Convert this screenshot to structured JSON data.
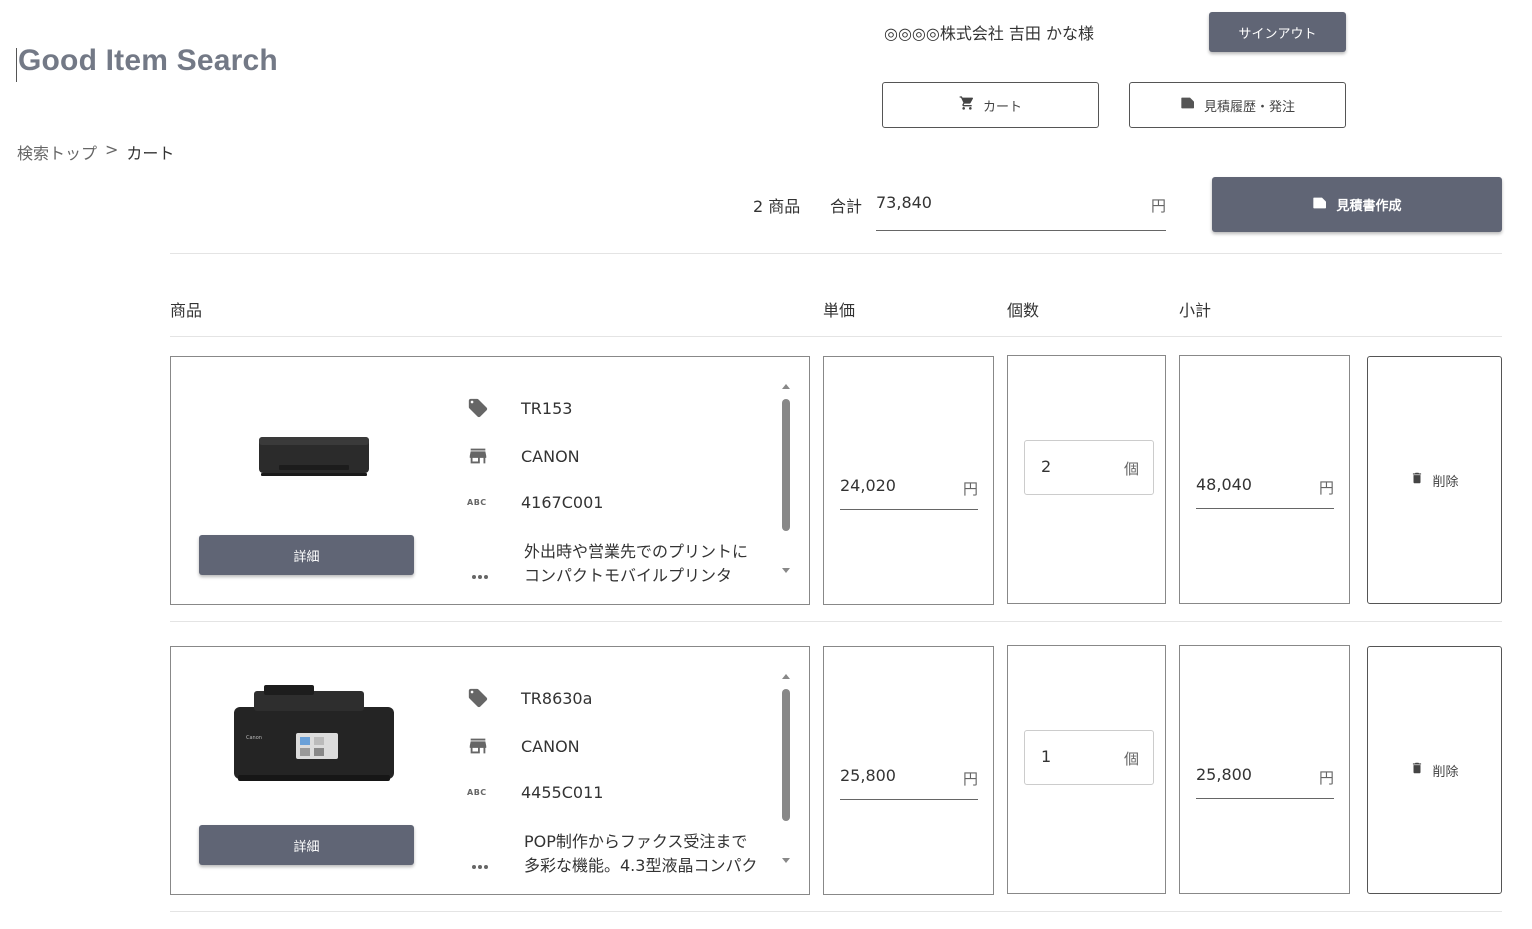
{
  "header": {
    "logo": "Good Item Search",
    "user_name": "◎◎◎◎株式会社 吉田 かな様",
    "signout_label": "サインアウト",
    "cart_label": "カート",
    "history_label": "見積履歴・発注"
  },
  "breadcrumb": {
    "top": "検索トップ",
    "separator": ">",
    "current": "カート"
  },
  "summary": {
    "count": "2 商品",
    "total_label": "合計",
    "total_value": "73,840",
    "unit": "円",
    "quote_button": "見積書作成"
  },
  "table_headers": {
    "product": "商品",
    "unit_price": "単価",
    "quantity": "個数",
    "subtotal": "小計"
  },
  "items": [
    {
      "model": "TR153",
      "maker": "CANON",
      "code": "4167C001",
      "desc_line1": "外出時や営業先でのプリントに",
      "desc_line2": "コンパクトモバイルプリンタ",
      "detail_label": "詳細",
      "unit_price": "24,020",
      "price_unit": "円",
      "quantity": "2",
      "qty_unit": "個",
      "subtotal": "48,040",
      "subtotal_unit": "円",
      "delete_label": "削除",
      "image_icon": "mobile-printer-image"
    },
    {
      "model": "TR8630a",
      "maker": "CANON",
      "code": "4455C011",
      "desc_line1": "POP制作からファクス受注まで",
      "desc_line2": "多彩な機能。4.3型液晶コンパク",
      "detail_label": "詳細",
      "unit_price": "25,800",
      "price_unit": "円",
      "quantity": "1",
      "qty_unit": "個",
      "subtotal": "25,800",
      "subtotal_unit": "円",
      "delete_label": "削除",
      "image_icon": "multifunction-printer-image"
    }
  ],
  "colors": {
    "dark_button": "#606575",
    "logo": "#737986",
    "border": "#888888"
  }
}
